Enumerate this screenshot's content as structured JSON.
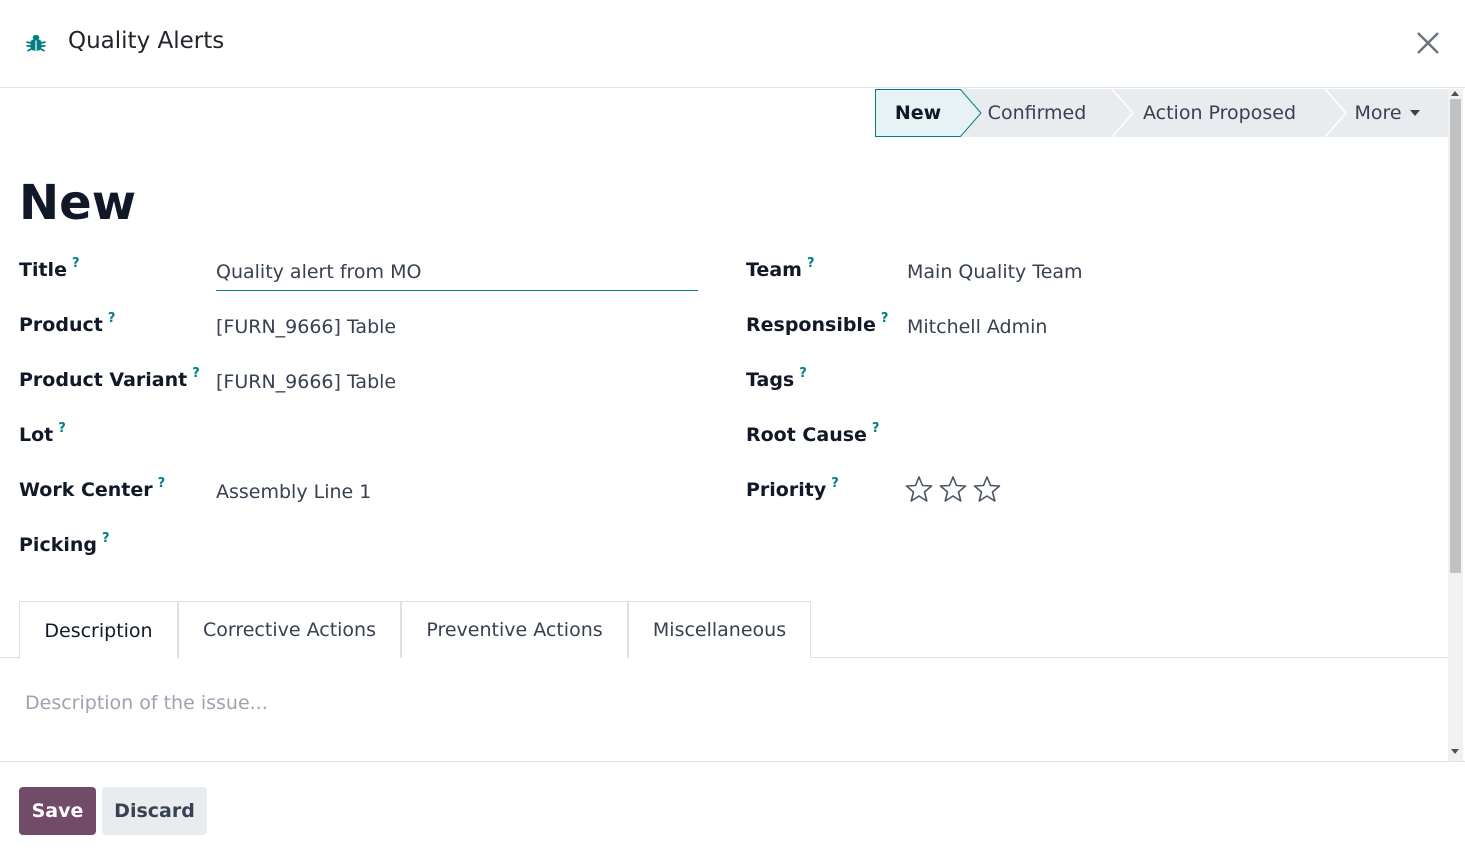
{
  "dialog": {
    "title": "Quality Alerts",
    "icon": "bug-icon",
    "close_icon": "close-icon"
  },
  "statusbar": {
    "stages": [
      "New",
      "Confirmed",
      "Action Proposed"
    ],
    "active": "New",
    "more_label": "More"
  },
  "record": {
    "name": "New"
  },
  "fields": {
    "title": {
      "label": "Title",
      "help": "?",
      "value": "Quality alert from MO"
    },
    "product": {
      "label": "Product",
      "help": "?",
      "value": "[FURN_9666] Table"
    },
    "product_variant": {
      "label": "Product Variant",
      "help": "?",
      "value": "[FURN_9666] Table"
    },
    "lot": {
      "label": "Lot",
      "help": "?",
      "value": ""
    },
    "work_center": {
      "label": "Work Center",
      "help": "?",
      "value": "Assembly Line 1"
    },
    "picking": {
      "label": "Picking",
      "help": "?",
      "value": ""
    },
    "team": {
      "label": "Team",
      "help": "?",
      "value": "Main Quality Team"
    },
    "responsible": {
      "label": "Responsible",
      "help": "?",
      "value": "Mitchell Admin"
    },
    "tags": {
      "label": "Tags",
      "help": "?",
      "value": ""
    },
    "root_cause": {
      "label": "Root Cause",
      "help": "?",
      "value": ""
    },
    "priority": {
      "label": "Priority",
      "help": "?",
      "stars_total": 3,
      "stars_selected": 0
    }
  },
  "tabs": [
    "Description",
    "Corrective Actions",
    "Preventive Actions",
    "Miscellaneous"
  ],
  "active_tab": "Description",
  "description": {
    "placeholder": "Description of the issue..."
  },
  "footer": {
    "save_label": "Save",
    "discard_label": "Discard"
  },
  "colors": {
    "primary": "#714b67",
    "accent": "#017e84",
    "active_stage_bg": "#e6f2f3",
    "stage_bg": "#e9ecef"
  }
}
